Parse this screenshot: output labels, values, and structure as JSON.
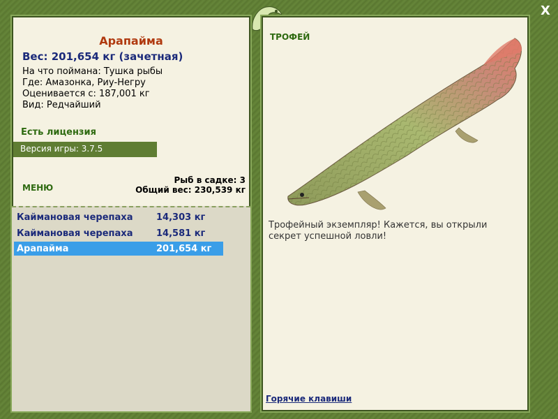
{
  "catch": {
    "name": "Арапайма",
    "weight_line": "Вес: 201,654 кг (зачетная)",
    "bait": "На что поймана: Тушка рыбы",
    "location": "Где: Амазонка, Риу-Негру",
    "evaluated_from": "Оценивается с: 187,001 кг",
    "rarity": "Вид: Редчайший"
  },
  "license": "Есть лицензия",
  "version": "Версия игры: 3.7.5",
  "menu_label": "МЕНЮ",
  "keepnet": {
    "fish_count": "Рыб в садке: 3",
    "total_weight": "Общий вес: 230,539 кг",
    "items": [
      {
        "name": "Каймановая черепаха",
        "weight": "14,303 кг"
      },
      {
        "name": "Каймановая черепаха",
        "weight": "14,581 кг"
      },
      {
        "name": "Арапайма",
        "weight": "201,654 кг",
        "selected": true
      }
    ]
  },
  "trophy": {
    "label": "ТРОФЕЙ",
    "text": "Трофейный экземпляр! Кажется, вы открыли секрет успешной ловли!"
  },
  "hotkeys": "Горячие клавиши",
  "close_label": "X",
  "colors": {
    "frame": "#5f7d33",
    "panel": "#f5f2e2",
    "accent_name": "#b03a10",
    "text_blue": "#1b2a7a",
    "selected": "#3a9ee8"
  }
}
